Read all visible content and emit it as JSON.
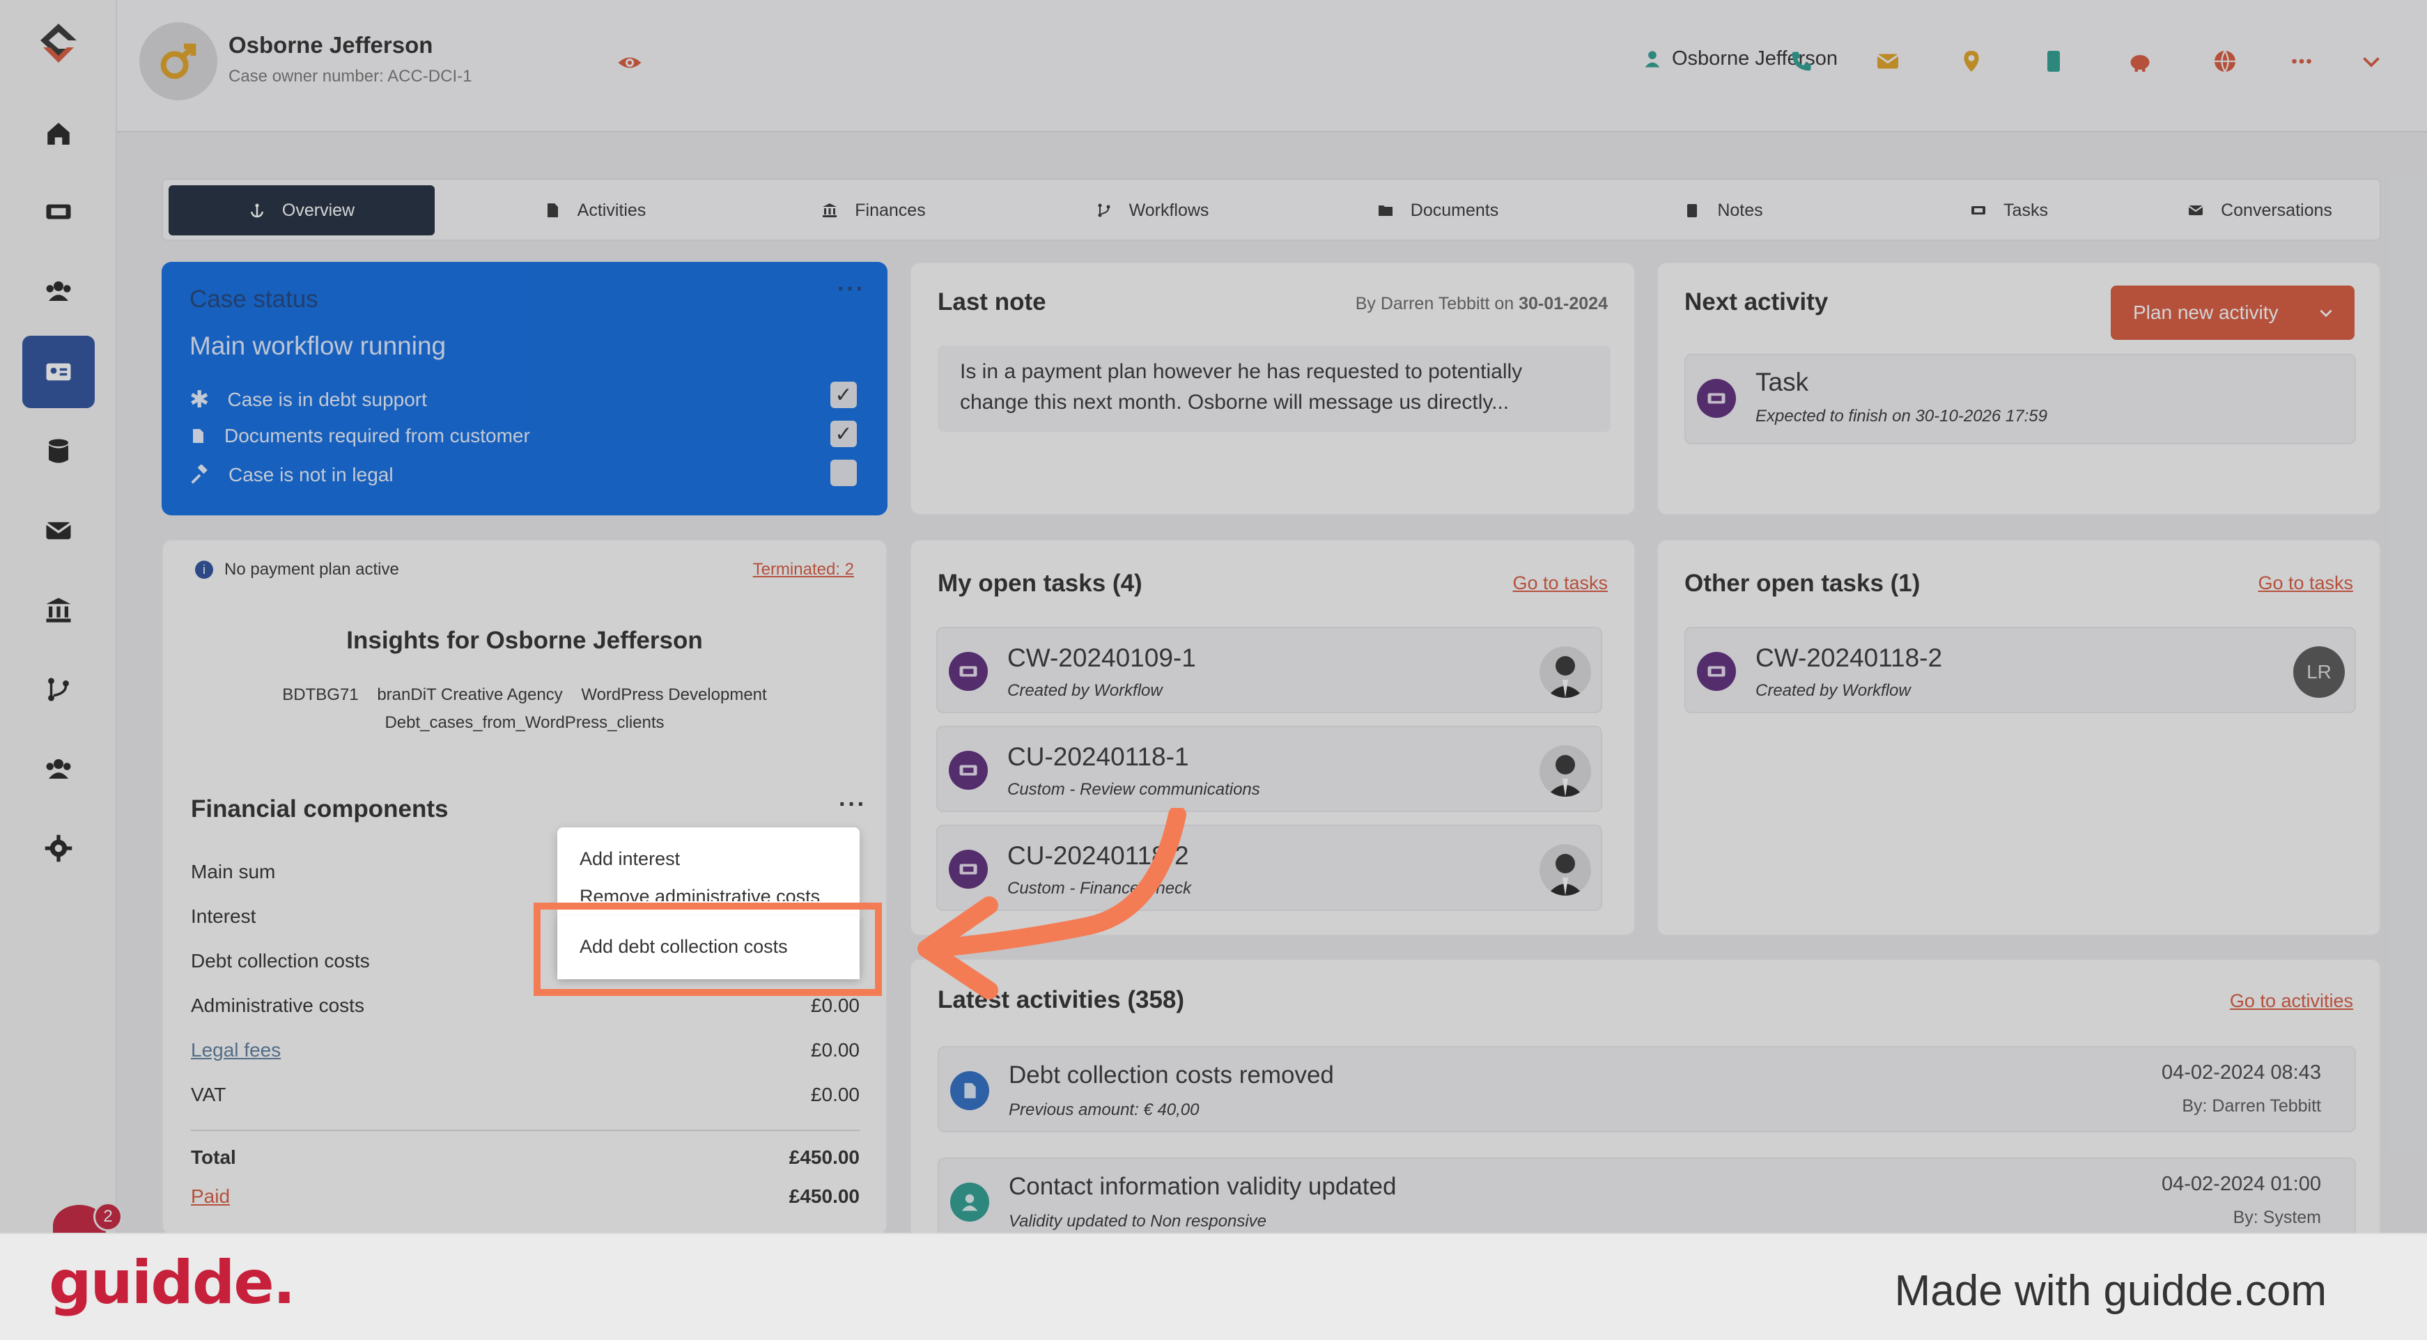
{
  "header": {
    "name": "Osborne Jefferson",
    "case_owner": "Case owner number: ACC-DCI-1",
    "user": "Osborne Jefferson"
  },
  "tabs": [
    {
      "label": "Overview",
      "icon": "anchor-icon"
    },
    {
      "label": "Activities",
      "icon": "document-icon"
    },
    {
      "label": "Finances",
      "icon": "bank-icon"
    },
    {
      "label": "Workflows",
      "icon": "branch-icon"
    },
    {
      "label": "Documents",
      "icon": "folder-icon"
    },
    {
      "label": "Notes",
      "icon": "clipboard-icon"
    },
    {
      "label": "Tasks",
      "icon": "ticket-icon"
    },
    {
      "label": "Conversations",
      "icon": "envelope-icon"
    }
  ],
  "case_status": {
    "title": "Case status",
    "subtitle": "Main workflow running",
    "rows": [
      {
        "label": "Case is in debt support",
        "checked": true
      },
      {
        "label": "Documents required from customer",
        "checked": true
      },
      {
        "label": "Case is not in legal",
        "checked": false
      }
    ]
  },
  "last_note": {
    "title": "Last note",
    "by_prefix": "By Darren Tebbitt on",
    "date": "30-01-2024",
    "text": "Is in a payment plan however he has requested to potentially change this next month. Osborne will message us directly..."
  },
  "next_activity": {
    "title": "Next activity",
    "button": "Plan new activity",
    "task_title": "Task",
    "task_sub": "Expected to finish on 30-10-2026 17:59"
  },
  "payment": {
    "status": "No payment plan active",
    "terminated": "Terminated: 2"
  },
  "insights": {
    "title": "Insights for Osborne Jefferson",
    "tags_line1": [
      "BDTBG71",
      "branDiT Creative Agency",
      "WordPress Development"
    ],
    "tags_line2": "Debt_cases_from_WordPress_clients"
  },
  "financial": {
    "title": "Financial components",
    "rows": [
      {
        "label": "Main sum",
        "value": ""
      },
      {
        "label": "Interest",
        "value": ""
      },
      {
        "label": "Debt collection costs",
        "value": ""
      },
      {
        "label": "Administrative costs",
        "value": "£0.00"
      },
      {
        "label": "Legal fees",
        "value": "£0.00"
      },
      {
        "label": "VAT",
        "value": "£0.00"
      }
    ],
    "total_label": "Total",
    "total_value": "£450.00",
    "paid_label": "Paid",
    "paid_value": "£450.00"
  },
  "menu": {
    "items": [
      "Add interest",
      "Remove administrative costs",
      "Add debt collection costs"
    ]
  },
  "my_tasks": {
    "title": "My open tasks (4)",
    "link": "Go to tasks",
    "items": [
      {
        "title": "CW-20240109-1",
        "sub": "Created by Workflow"
      },
      {
        "title": "CU-20240118-1",
        "sub": "Custom - Review communications"
      },
      {
        "title": "CU-20240118-2",
        "sub": "Custom - Finance Check"
      }
    ]
  },
  "other_tasks": {
    "title": "Other open tasks (1)",
    "link": "Go to tasks",
    "items": [
      {
        "title": "CW-20240118-2",
        "sub": "Created by Workflow",
        "avatar": "LR"
      }
    ]
  },
  "latest": {
    "title": "Latest activities (358)",
    "link": "Go to activities",
    "items": [
      {
        "title": "Debt collection costs removed",
        "sub": "Previous amount: € 40,00",
        "date": "04-02-2024 08:43",
        "by": "By: Darren Tebbitt"
      },
      {
        "title": "Contact information validity updated",
        "sub": "Validity updated to Non responsive",
        "date": "04-02-2024 01:00",
        "by": "By: System"
      }
    ]
  },
  "badge_count": "2",
  "footer": {
    "logo": "guidde.",
    "made_with": "Made with guidde.com"
  },
  "colors": {
    "accent": "#0d6be0",
    "brand_orange": "#d8573a",
    "highlight": "#f47c55",
    "task_purple": "#5b2a7a"
  }
}
